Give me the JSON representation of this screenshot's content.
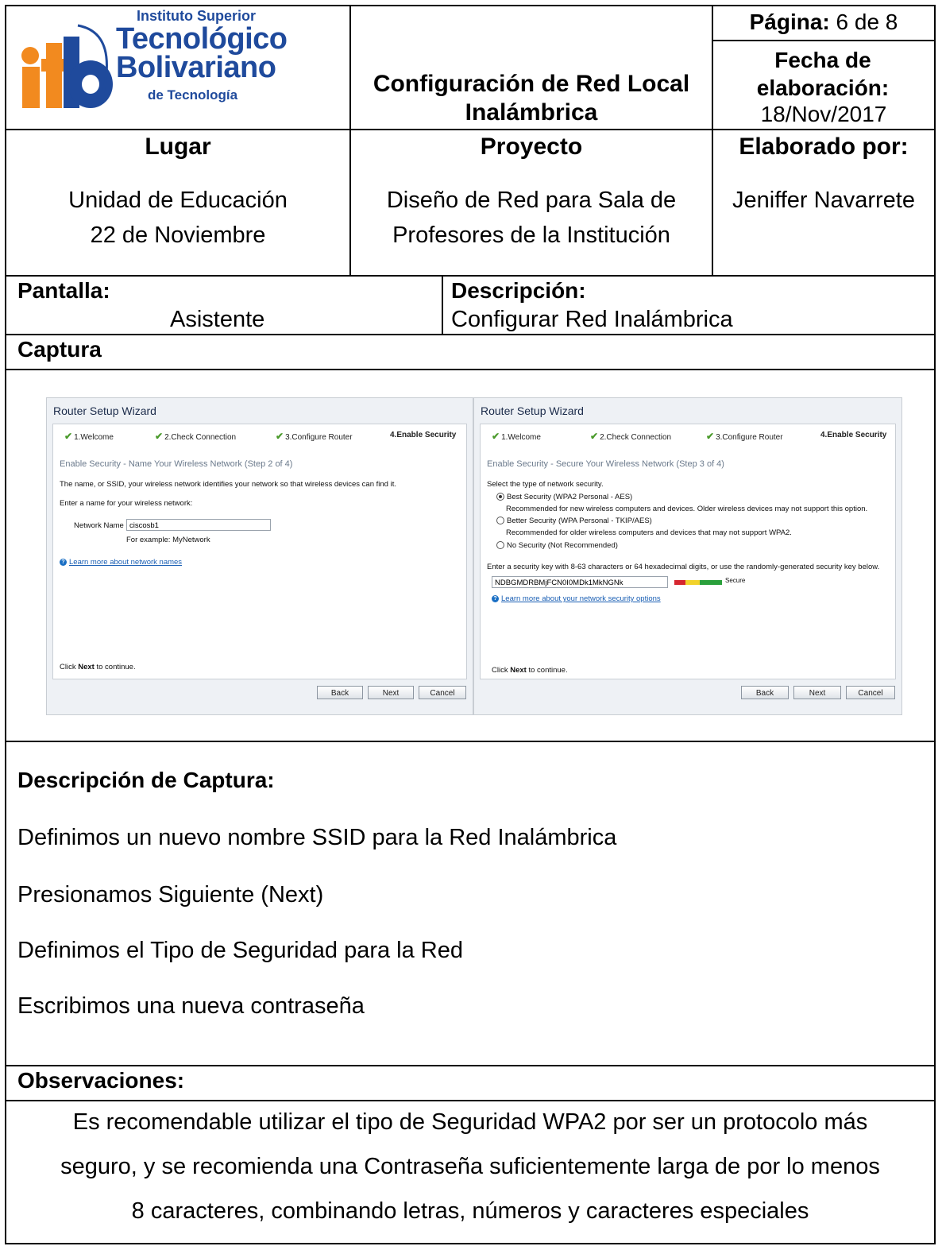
{
  "header": {
    "logo": {
      "text_line1": "Instituto Superior",
      "text_line2": "Tecnológico",
      "text_line3": "Bolivariano",
      "text_line4": "de Tecnología"
    },
    "title": "Configuración de Red Local Inalámbrica",
    "page_label": "Página:",
    "page_value": "6 de 8",
    "date_label": "Fecha de elaboración:",
    "date_value": "18/Nov/2017"
  },
  "info": {
    "lugar_label": "Lugar",
    "lugar_line1": "Unidad de Educación",
    "lugar_line2": "22 de Noviembre",
    "proyecto_label": "Proyecto",
    "proyecto_line1": "Diseño de Red para Sala de",
    "proyecto_line2": "Profesores de la Institución",
    "elaborado_label": "Elaborado por:",
    "elaborado_value": "Jeniffer Navarrete"
  },
  "pantalla": {
    "label": "Pantalla:",
    "value": "Asistente",
    "desc_label": "Descripción:",
    "desc_value": "Configurar Red Inalámbrica"
  },
  "captura_label": "Captura",
  "wizard_left": {
    "title": "Router Setup Wizard",
    "steps": [
      "1.Welcome",
      "2.Check Connection",
      "3.Configure Router",
      "4.Enable Security"
    ],
    "subtitle": "Enable Security - Name Your Wireless Network (Step 2 of 4)",
    "text1": "The name, or SSID, your wireless network identifies your network so that wireless devices can find it.",
    "text2": "Enter a name for your wireless network:",
    "network_name_label": "Network Name",
    "network_name_value": "ciscosb1",
    "example": "For example: MyNetwork",
    "learn_more": "Learn more about network names",
    "click_prefix": "Click ",
    "click_bold": "Next",
    "click_suffix": " to continue.",
    "btn_back": "Back",
    "btn_next": "Next",
    "btn_cancel": "Cancel"
  },
  "wizard_right": {
    "title": "Router Setup Wizard",
    "steps": [
      "1.Welcome",
      "2.Check Connection",
      "3.Configure Router",
      "4.Enable Security"
    ],
    "subtitle": "Enable Security - Secure Your Wireless Network (Step 3 of 4)",
    "select_text": "Select the type of network security.",
    "opt1": "Best Security (WPA2 Personal - AES)",
    "opt1_desc": "Recommended for new wireless computers and devices. Older wireless devices may not support this option.",
    "opt2": "Better Security (WPA Personal - TKIP/AES)",
    "opt2_desc": "Recommended for older wireless computers and devices that may not support WPA2.",
    "opt3": "No Security (Not Recommended)",
    "key_text": "Enter a security key with 8-63 characters or 64 hexadecimal digits, or use the randomly-generated security key below.",
    "key_value": "NDBGMDRBMjFCN0I0MDk1MkNGNk",
    "strength_label": "Secure",
    "learn_more": "Learn more about your network security options",
    "click_prefix": "Click ",
    "click_bold": "Next",
    "click_suffix": " to continue.",
    "btn_back": "Back",
    "btn_next": "Next",
    "btn_cancel": "Cancel"
  },
  "descripcion_captura": {
    "label": "Descripción de Captura:",
    "items": [
      "Definimos un nuevo nombre SSID para la Red Inalámbrica",
      "Presionamos Siguiente (Next)",
      "Definimos el Tipo de Seguridad para la Red",
      "Escribimos una nueva contraseña"
    ]
  },
  "observaciones": {
    "label": "Observaciones:",
    "line1": "Es recomendable utilizar el tipo de Seguridad WPA2 por ser un protocolo más",
    "line2": "seguro, y se recomienda una Contraseña suficientemente larga de por lo menos",
    "line3": "8 caracteres, combinando letras, números y caracteres especiales"
  },
  "colors": {
    "logo_orange": "#f28a1f",
    "logo_blue": "#1f4a9c",
    "link_blue": "#1a5fb4",
    "check_green": "#4a9a2b"
  }
}
